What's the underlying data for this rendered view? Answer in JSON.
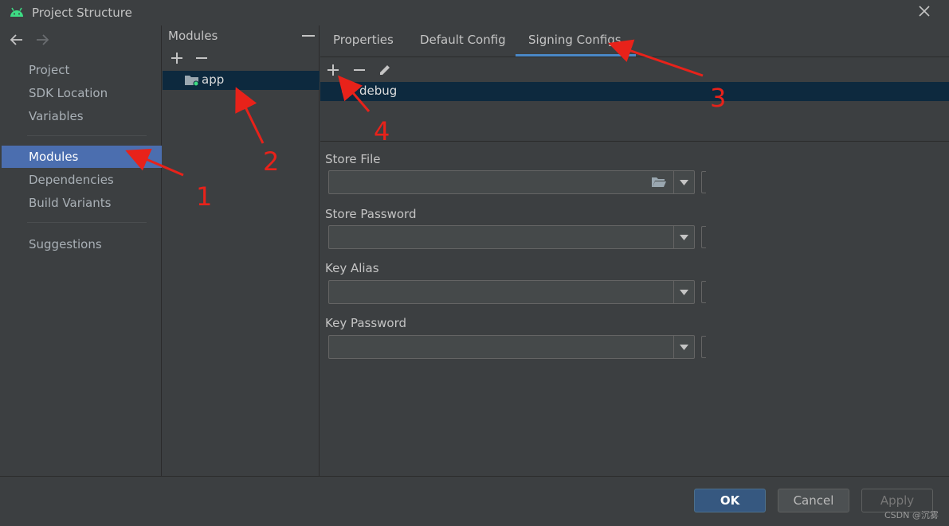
{
  "window": {
    "title": "Project Structure"
  },
  "nav": {
    "items": [
      {
        "label": "Project"
      },
      {
        "label": "SDK Location"
      },
      {
        "label": "Variables"
      },
      {
        "label": "Modules"
      },
      {
        "label": "Dependencies"
      },
      {
        "label": "Build Variants"
      },
      {
        "label": "Suggestions"
      }
    ],
    "selected": "Modules"
  },
  "modules": {
    "header": "Modules",
    "items": [
      {
        "label": "app"
      }
    ]
  },
  "main": {
    "tabs": [
      {
        "label": "Properties"
      },
      {
        "label": "Default Config"
      },
      {
        "label": "Signing Configs"
      }
    ],
    "active_tab": "Signing Configs",
    "signing_configs": [
      {
        "label": "debug"
      }
    ],
    "fields": [
      {
        "label": "Store File",
        "value": ""
      },
      {
        "label": "Store Password",
        "value": ""
      },
      {
        "label": "Key Alias",
        "value": ""
      },
      {
        "label": "Key Password",
        "value": ""
      }
    ]
  },
  "footer": {
    "ok_label": "OK",
    "cancel_label": "Cancel",
    "apply_label": "Apply",
    "watermark": "CSDN @沉雾"
  },
  "annotations": [
    "1",
    "2",
    "3",
    "4"
  ],
  "colors": {
    "selection": "#4b6eaf",
    "tree_selection": "#0d293e",
    "annotation": "#e8221a",
    "ok_button": "#365880",
    "tab_underline": "#4a88c7"
  }
}
